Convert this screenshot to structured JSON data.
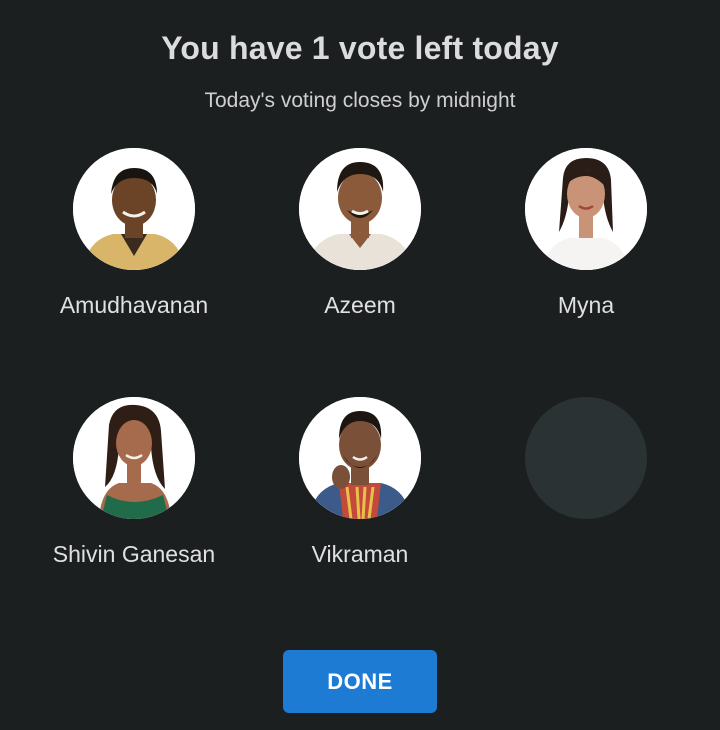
{
  "header": {
    "title": "You have 1 vote left today",
    "subtitle": "Today's voting closes by midnight"
  },
  "contestants": [
    {
      "name": "Amudhavanan",
      "icon": "person-avatar",
      "skin": "#6b4326",
      "hair": "#1a1410",
      "outfit": "#d9b56a"
    },
    {
      "name": "Azeem",
      "icon": "person-avatar",
      "skin": "#8a5a3a",
      "hair": "#1f1712",
      "outfit": "#e8e2d8"
    },
    {
      "name": "Myna",
      "icon": "person-avatar",
      "skin": "#c99378",
      "hair": "#2a1c16",
      "outfit": "#f6f4f2"
    },
    {
      "name": "Shivin Ganesan",
      "icon": "person-avatar",
      "skin": "#a66a4c",
      "hair": "#2e1e15",
      "outfit": "#1f6b4a"
    },
    {
      "name": "Vikraman",
      "icon": "person-avatar",
      "skin": "#7a5038",
      "hair": "#1c1511",
      "outfit": "#c34a3a"
    }
  ],
  "empty_slot": {
    "color": "#2b3233"
  },
  "done_button": {
    "label": "DONE",
    "color": "#1e7bd4"
  }
}
